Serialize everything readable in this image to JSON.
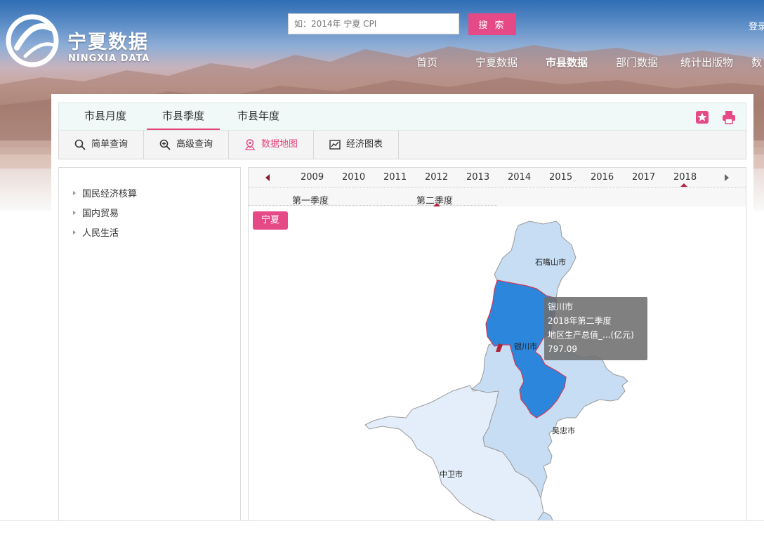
{
  "header": {
    "logo_cn": "宁夏数据",
    "logo_en": "NINGXIA DATA",
    "search_placeholder": "如：2014年 宁夏 CPI",
    "search_button": "搜 索",
    "login": "登录",
    "nav": [
      "首页",
      "宁夏数据",
      "市县数据",
      "部门数据",
      "统计出版物",
      "数"
    ]
  },
  "tabs": [
    "市县月度",
    "市县季度",
    "市县年度"
  ],
  "active_tab": "市县季度",
  "tab_icons": [
    "star-icon",
    "print-icon"
  ],
  "toolbar": {
    "simple_query": "简单查询",
    "advanced_query": "高级查询",
    "data_map": "数据地图",
    "economic_chart": "经济图表"
  },
  "tree": [
    "国民经济核算",
    "国内贸易",
    "人民生活"
  ],
  "years": [
    "2009",
    "2010",
    "2011",
    "2012",
    "2013",
    "2014",
    "2015",
    "2016",
    "2017",
    "2018"
  ],
  "selected_year": "2018",
  "quarters": [
    "第一季度",
    "第二季度"
  ],
  "selected_quarter": "第二季度",
  "region_button": "宁夏",
  "map": {
    "cities": [
      "石嘴山市",
      "银川市",
      "吴忠市",
      "中卫市"
    ],
    "highlighted": "银川市"
  },
  "tooltip": {
    "city": "银川市",
    "period": "2018年第二季度",
    "indicator": "地区生产总值_...(亿元)",
    "value": "797.09"
  },
  "colors": {
    "accent": "#e64a86",
    "highlight_city": "#2b86dc",
    "map_light": "#c7ddf3",
    "map_lighter": "#e4eefa"
  }
}
